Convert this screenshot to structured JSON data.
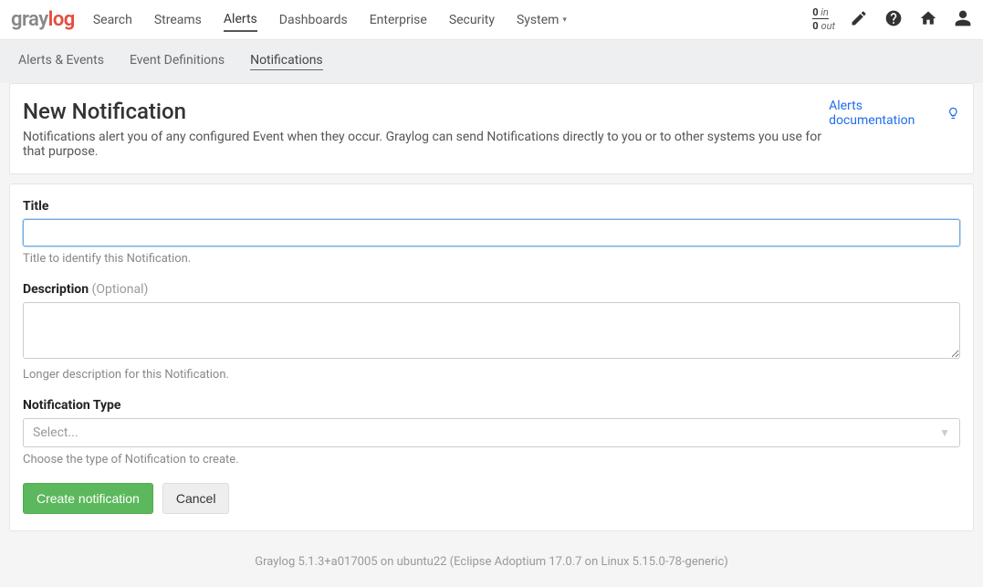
{
  "logo": {
    "part1": "gray",
    "part2": "log"
  },
  "nav": {
    "search": "Search",
    "streams": "Streams",
    "alerts": "Alerts",
    "dashboards": "Dashboards",
    "enterprise": "Enterprise",
    "security": "Security",
    "system": "System"
  },
  "throughput": {
    "in_num": "0",
    "in_lbl": "in",
    "out_num": "0",
    "out_lbl": "out"
  },
  "subnav": {
    "alerts_events": "Alerts & Events",
    "event_definitions": "Event Definitions",
    "notifications": "Notifications"
  },
  "header": {
    "title": "New Notification",
    "subtitle": "Notifications alert you of any configured Event when they occur. Graylog can send Notifications directly to you or to other systems you use for that purpose.",
    "doc_link": "Alerts documentation"
  },
  "form": {
    "title_label": "Title",
    "title_value": "",
    "title_help": "Title to identify this Notification.",
    "description_label": "Description ",
    "description_optional": "(Optional)",
    "description_value": "",
    "description_help": "Longer description for this Notification.",
    "type_label": "Notification Type",
    "type_placeholder": "Select...",
    "type_help": "Choose the type of Notification to create.",
    "create_button": "Create notification",
    "cancel_button": "Cancel"
  },
  "footer": {
    "text": "Graylog 5.1.3+a017005 on ubuntu22 (Eclipse Adoptium 17.0.7 on Linux 5.15.0-78-generic)"
  }
}
